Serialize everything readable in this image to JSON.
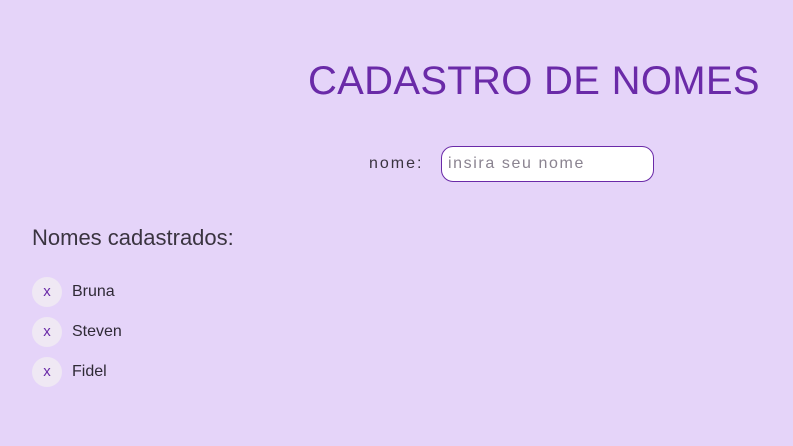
{
  "header": {
    "title": "CADASTRO DE NOMES"
  },
  "form": {
    "label": "nome:",
    "placeholder": "insira seu nome",
    "value": ""
  },
  "list": {
    "heading": "Nomes cadastrados:",
    "remove_label": "x",
    "items": [
      {
        "name": "Bruna"
      },
      {
        "name": "Steven"
      },
      {
        "name": "Fidel"
      }
    ]
  },
  "colors": {
    "background": "#e5d4f9",
    "accent": "#6a2aa8",
    "remove_button_bg": "#efe8f4"
  }
}
